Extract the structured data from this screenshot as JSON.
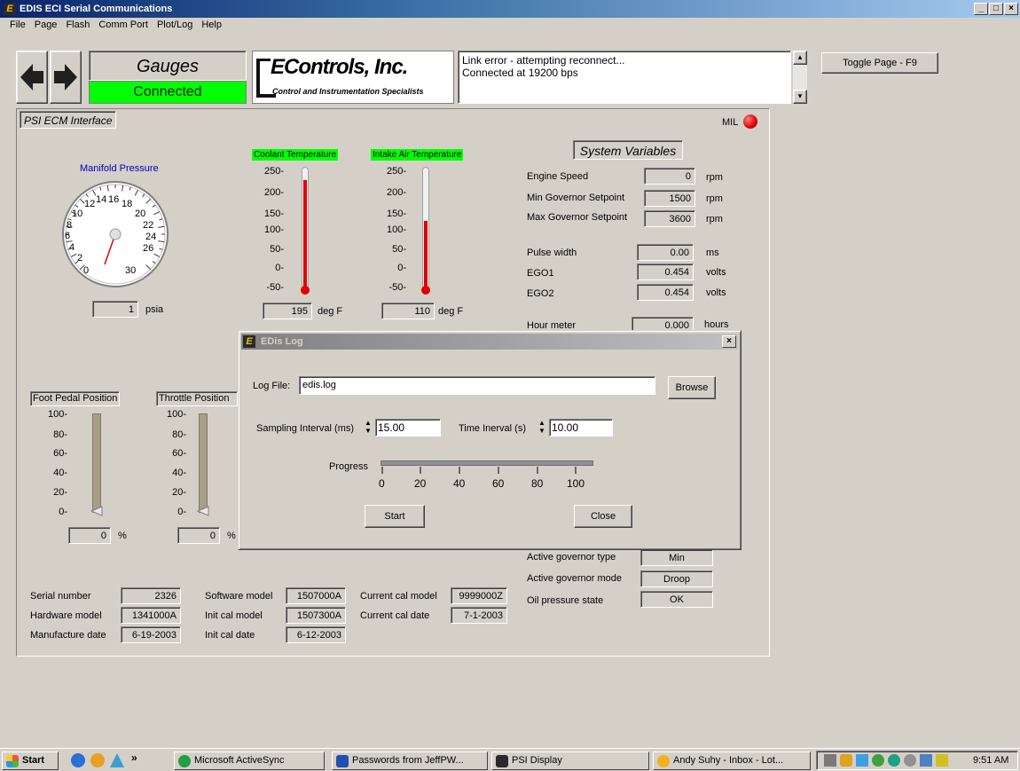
{
  "window": {
    "title": "EDIS ECI Serial Communications"
  },
  "menu": [
    "File",
    "Page",
    "Flash",
    "Comm Port",
    "Plot/Log",
    "Help"
  ],
  "toolbar": {
    "page_title": "Gauges",
    "status": "Connected",
    "logo_main": "EControls, Inc.",
    "logo_sub": "Control and Instrumentation Specialists",
    "messages": [
      "Link error - attempting reconnect...",
      "Connected at 19200 bps"
    ],
    "toggle_button": "Toggle Page - F9"
  },
  "panel": {
    "title": "PSI ECM Interface",
    "mil_label": "MIL"
  },
  "manifold": {
    "label": "Manifold Pressure",
    "dial_numbers": [
      "0",
      "2",
      "4",
      "6",
      "8",
      "10",
      "12",
      "14",
      "16",
      "18",
      "20",
      "22",
      "24",
      "26",
      "30"
    ],
    "value": "1",
    "unit": "psia"
  },
  "coolant": {
    "label": "Coolant Temperature",
    "ticks": [
      "250-",
      "200-",
      "150-",
      "100-",
      "50-",
      "0-",
      "-50-"
    ],
    "level_pct": 90,
    "value": "195",
    "unit": "deg F"
  },
  "intake": {
    "label": "Intake Air Temperature",
    "ticks": [
      "250-",
      "200-",
      "150-",
      "100-",
      "50-",
      "0-",
      "-50-"
    ],
    "level_pct": 56,
    "value": "110",
    "unit": "deg F"
  },
  "system_variables": {
    "title": "System Variables",
    "rows": [
      {
        "label": "Engine Speed",
        "value": "0",
        "unit": "rpm"
      },
      {
        "label": "Min Governor Setpoint",
        "value": "1500",
        "unit": "rpm"
      },
      {
        "label": "Max Governor Setpoint",
        "value": "3600",
        "unit": "rpm"
      },
      {
        "label": "Pulse width",
        "value": "0.00",
        "unit": "ms"
      },
      {
        "label": "EGO1",
        "value": "0.454",
        "unit": "volts"
      },
      {
        "label": "EGO2",
        "value": "0.454",
        "unit": "volts"
      },
      {
        "label": "Hour meter",
        "value": "0.000",
        "unit": "hours"
      }
    ]
  },
  "foot_pedal": {
    "label": "Foot Pedal Position",
    "ticks": [
      "100-",
      "80-",
      "60-",
      "40-",
      "20-",
      "0-"
    ],
    "value": "0",
    "unit": "%"
  },
  "throttle": {
    "label": "Throttle Position",
    "ticks": [
      "100-",
      "80-",
      "60-",
      "40-",
      "20-",
      "0-"
    ],
    "value": "0",
    "unit": "%"
  },
  "governor": [
    {
      "label": "Active governor type",
      "value": "Min"
    },
    {
      "label": "Active governor mode",
      "value": "Droop"
    },
    {
      "label": "Oil pressure state",
      "value": "OK"
    }
  ],
  "info": [
    {
      "label": "Serial number",
      "value": "2326"
    },
    {
      "label": "Hardware model",
      "value": "1341000A"
    },
    {
      "label": "Manufacture date",
      "value": "6-19-2003"
    },
    {
      "label": "Software model",
      "value": "1507000A"
    },
    {
      "label": "Init cal model",
      "value": "1507300A"
    },
    {
      "label": "Init cal date",
      "value": "6-12-2003"
    },
    {
      "label": "Current cal model",
      "value": "9999000Z"
    },
    {
      "label": "Current cal date",
      "value": "7-1-2003"
    }
  ],
  "log_dialog": {
    "title": "EDis Log",
    "log_file_label": "Log File:",
    "log_file_value": "edis.log",
    "browse": "Browse",
    "sampling_label": "Sampling Interval (ms)",
    "sampling_value": "15.00",
    "time_label": "Time Inerval (s)",
    "time_value": "10.00",
    "progress_label": "Progress",
    "progress_ticks": [
      "0",
      "20",
      "40",
      "60",
      "80",
      "100"
    ],
    "progress_value": 0,
    "start": "Start",
    "close": "Close"
  },
  "taskbar": {
    "start": "Start",
    "items": [
      "Microsoft ActiveSync",
      "Passwords from JeffPW...",
      "PSI Display",
      "Andy Suhy - Inbox - Lot..."
    ],
    "clock": "9:51 AM"
  }
}
